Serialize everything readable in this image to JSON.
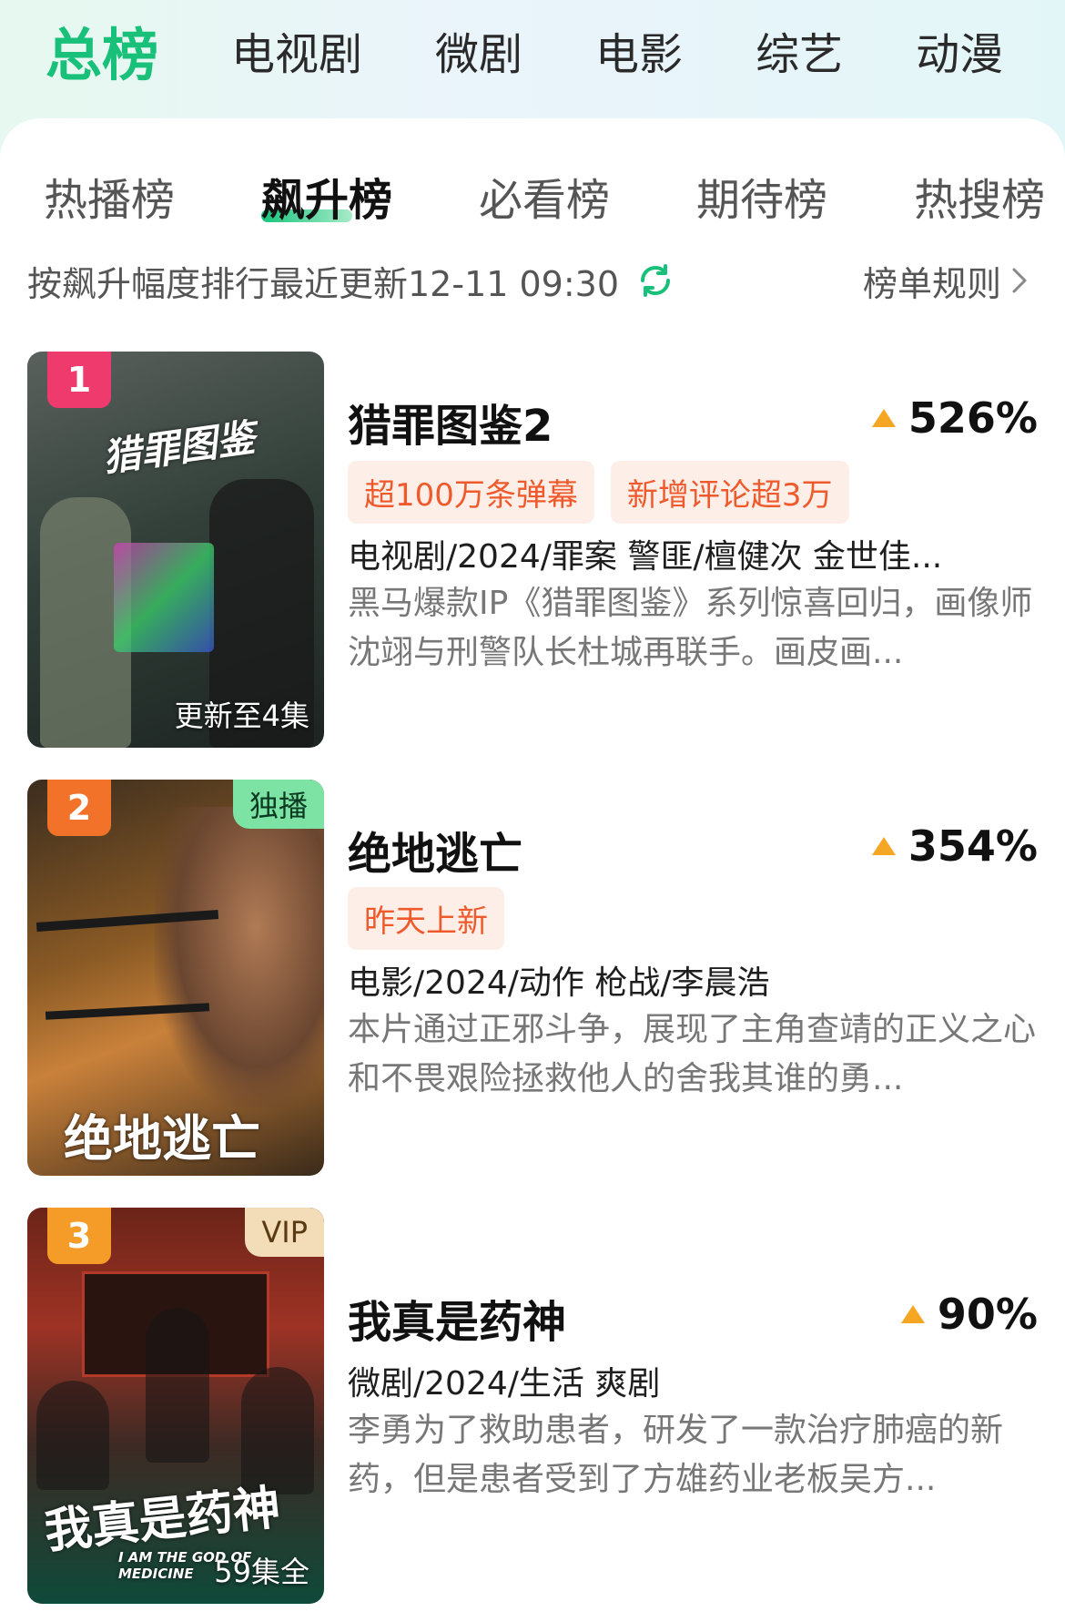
{
  "category_tabs": [
    "总榜",
    "电视剧",
    "微剧",
    "电影",
    "综艺",
    "动漫"
  ],
  "sub_tabs": [
    "热播榜",
    "飙升榜",
    "必看榜",
    "期待榜",
    "热搜榜"
  ],
  "info": {
    "description": "按飙升幅度排行最近更新12-11 09:30",
    "rules_link": "榜单规则"
  },
  "items": [
    {
      "rank": "1",
      "title": "猎罪图鉴2",
      "trend": "526%",
      "tags": [
        "超100万条弹幕",
        "新增评论超3万"
      ],
      "meta": "电视剧/2024/罪案 警匪/檀健次 金世佳...",
      "description": "黑马爆款IP《猎罪图鉴》系列惊喜回归，画像师沈翊与刑警队长杜城再联手。画皮画...",
      "poster_status": "更新至4集",
      "poster_art": "猎罪图鉴"
    },
    {
      "rank": "2",
      "title": "绝地逃亡",
      "trend": "354%",
      "tags": [
        "昨天上新"
      ],
      "meta": "电影/2024/动作 枪战/李晨浩",
      "description": "本片通过正邪斗争，展现了主角查靖的正义之心和不畏艰险拯救他人的舍我其谁的勇...",
      "corner_badge": "独播",
      "poster_art": "绝地逃亡"
    },
    {
      "rank": "3",
      "title": "我真是药神",
      "trend": "90%",
      "meta": "微剧/2024/生活 爽剧",
      "description": "李勇为了救助患者，研发了一款治疗肺癌的新药，但是患者受到了方雄药业老板吴方...",
      "corner_badge": "VIP",
      "poster_status": "59集全",
      "poster_art": "我真是药神",
      "poster_art_en": "I AM THE GOD OF MEDICINE"
    }
  ],
  "colors": {
    "accent_green": "#18c07a",
    "trend_orange": "#f5a623",
    "tag_text": "#ef5a2c",
    "tag_bg": "#fdeee7"
  },
  "icons": {
    "refresh": "refresh-icon",
    "chevron": "chevron-right-icon",
    "trend": "trend-up-icon"
  }
}
